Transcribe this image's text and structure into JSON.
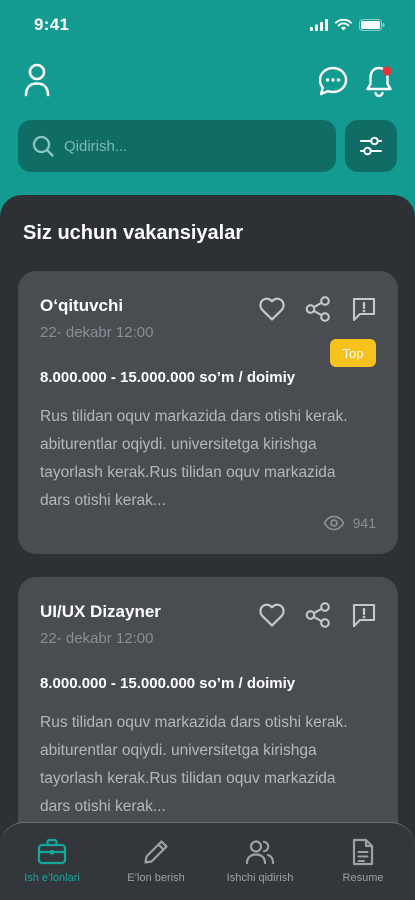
{
  "status_bar": {
    "time": "9:41",
    "icons": [
      "signal-icon",
      "wifi-icon",
      "battery-icon"
    ]
  },
  "header": {
    "profile_icon": "user-icon",
    "chat_icon": "chat-bubble-icon",
    "bell_icon": "bell-icon",
    "has_notification": true
  },
  "search": {
    "placeholder": "Qidirish...",
    "value": "",
    "filter_icon": "sliders-icon"
  },
  "main": {
    "section_title": "Siz uchun vakansiyalar",
    "cards": [
      {
        "title": "O‘qituvchi",
        "date": "22- dekabr 12:00",
        "badge": "Top",
        "salary": "8.000.000 - 15.000.000 so’m / doimiy",
        "description": "Rus tilidan  oquv markazida dars otishi kerak. abiturentlar oqiydi. universitetga kirishga tayorlash kerak.Rus tilidan  oquv markazida dars otishi kerak...",
        "views": "941"
      },
      {
        "title": "UI/UX Dizayner",
        "date": "22- dekabr 12:00",
        "salary": "8.000.000 - 15.000.000 so’m / doimiy",
        "description": "Rus tilidan  oquv markazida dars otishi kerak. abiturentlar oqiydi. universitetga kirishga tayorlash kerak.Rus tilidan  oquv markazida dars otishi kerak..."
      }
    ]
  },
  "bottom_nav": {
    "items": [
      {
        "label": "Ish e’lonlari",
        "icon": "briefcase-icon",
        "active": true
      },
      {
        "label": "E’lon berish",
        "icon": "pencil-icon",
        "active": false
      },
      {
        "label": "Ishchi qidirish",
        "icon": "users-icon",
        "active": false
      },
      {
        "label": "Resume",
        "icon": "document-icon",
        "active": false
      }
    ]
  },
  "colors": {
    "brand": "#139a91",
    "sheet": "#2d3034",
    "card": "#494d52",
    "badge": "#f7c11e",
    "notification": "#e8323a",
    "active_nav": "#15a79d"
  }
}
